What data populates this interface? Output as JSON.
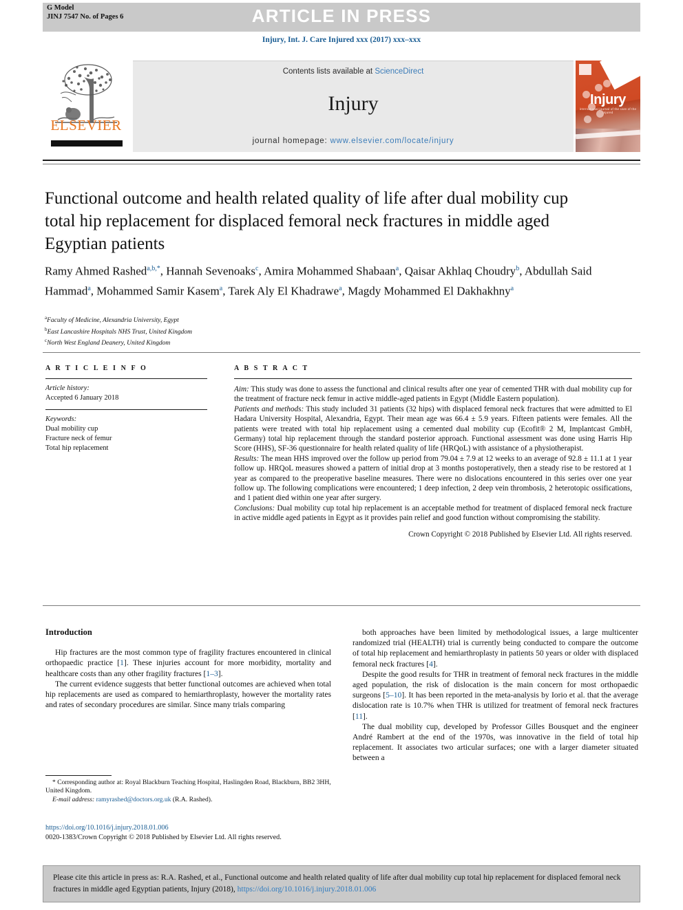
{
  "header": {
    "g_model_line1": "G Model",
    "g_model_line2": "JINJ 7547 No. of Pages 6",
    "article_in_press": "ARTICLE IN PRESS",
    "journal_citation": "Injury, Int. J. Care Injured xxx (2017) xxx–xxx"
  },
  "masthead": {
    "contents_prefix": "Contents lists available at ",
    "sciencedirect": "ScienceDirect",
    "journal_name": "Injury",
    "homepage_label": "journal homepage: ",
    "homepage_url": "www.elsevier.com/locate/injury",
    "publisher": "ELSEVIER",
    "cover_title": "Injury",
    "cover_subtitle": "international journal of the care of the injured"
  },
  "article": {
    "title": "Functional outcome and health related quality of life after dual mobility cup total hip replacement for displaced femoral neck fractures in middle aged Egyptian patients",
    "authors": [
      {
        "name": "Ramy Ahmed Rashed",
        "sup": "a,b,*"
      },
      {
        "name": "Hannah Sevenoaks",
        "sup": "c"
      },
      {
        "name": "Amira Mohammed Shabaan",
        "sup": "a"
      },
      {
        "name": "Qaisar Akhlaq Choudry",
        "sup": "b"
      },
      {
        "name": "Abdullah Said Hammad",
        "sup": "a"
      },
      {
        "name": "Mohammed Samir Kasem",
        "sup": "a"
      },
      {
        "name": "Tarek Aly El Khadrawe",
        "sup": "a"
      },
      {
        "name": "Magdy Mohammed El Dakhakhny",
        "sup": "a"
      }
    ],
    "affiliations": [
      {
        "mark": "a",
        "text": "Faculty of Medicine, Alexandria University, Egypt"
      },
      {
        "mark": "b",
        "text": "East Lancashire Hospitals NHS Trust, United Kingdom"
      },
      {
        "mark": "c",
        "text": "North West England Deanery, United Kingdom"
      }
    ]
  },
  "article_info": {
    "heading": "A R T I C L E  I N F O",
    "history_label": "Article history:",
    "history_value": "Accepted 6 January 2018",
    "keywords_label": "Keywords:",
    "keywords": [
      "Dual mobility cup",
      "Fracture neck of femur",
      "Total hip replacement"
    ]
  },
  "abstract": {
    "heading": "A B S T R A C T",
    "sections": [
      {
        "label": "Aim:",
        "text": " This study was done to assess the functional and clinical results after one year of cemented THR with dual mobility cup for the treatment of fracture neck femur in active middle-aged patients in Egypt (Middle Eastern population)."
      },
      {
        "label": "Patients and methods:",
        "text": " This study included 31 patients (32 hips) with displaced femoral neck fractures that were admitted to El Hadara University Hospital, Alexandria, Egypt. Their mean age was 66.4 ± 5.9 years. Fifteen patients were females. All the patients were treated with total hip replacement using a cemented dual mobility cup (Ecofit® 2 M, Implantcast GmbH, Germany) total hip replacement through the standard posterior approach. Functional assessment was done using Harris Hip Score (HHS), SF-36 questionnaire for health related quality of life (HRQoL) with assistance of a physiotherapist."
      },
      {
        "label": "Results:",
        "text": " The mean HHS improved over the follow up period from 79.04 ± 7.9 at 12 weeks to an average of 92.8 ± 11.1 at 1 year follow up. HRQoL measures showed a pattern of initial drop at 3 months postoperatively, then a steady rise to be restored at 1 year as compared to the preoperative baseline measures. There were no dislocations encountered in this series over one year follow up. The following complications were encountered; 1 deep infection, 2 deep vein thrombosis, 2 heterotopic ossifications, and 1 patient died within one year after surgery."
      },
      {
        "label": "Conclusions:",
        "text": " Dual mobility cup total hip replacement is an acceptable method for treatment of displaced femoral neck fracture in active middle aged patients in Egypt as it provides pain relief and good function without compromising the stability."
      }
    ],
    "copyright": "Crown Copyright © 2018 Published by Elsevier Ltd. All rights reserved."
  },
  "introduction": {
    "heading": "Introduction",
    "left_paragraphs": [
      "Hip fractures are the most common type of fragility fractures encountered in clinical orthopaedic practice [1]. These injuries account for more morbidity, mortality and healthcare costs than any other fragility fractures [1–3].",
      "The current evidence suggests that better functional outcomes are achieved when total hip replacements are used as compared to hemiarthroplasty, however the mortality rates and rates of secondary procedures are similar. Since many trials comparing"
    ],
    "right_paragraphs": [
      "both approaches have been limited by methodological issues, a large multicenter randomized trial (HEALTH) trial is currently being conducted to compare the outcome of total hip replacement and hemiarthroplasty in patients 50 years or older with displaced femoral neck fractures [4].",
      "Despite the good results for THR in treatment of femoral neck fractures in the middle aged population, the risk of dislocation is the main concern for most orthopaedic surgeons [5–10]. It has been reported in the meta-analysis by Iorio et al. that the average dislocation rate is 10.7% when THR is utilized for treatment of femoral neck fractures [11].",
      "The dual mobility cup, developed by Professor Gilles Bousquet and the engineer André Rambert at the end of the 1970s, was innovative in the field of total hip replacement. It associates two articular surfaces; one with a larger diameter situated between a"
    ]
  },
  "footnote": {
    "corresponding_marker": "*",
    "corresponding_text": " Corresponding author at: Royal Blackburn Teaching Hospital, Haslingden Road, Blackburn, BB2 3HH, United Kingdom.",
    "email_label": "E-mail address:",
    "email_address": "ramyrashed@doctors.org.uk",
    "email_owner": " (R.A. Rashed).",
    "doi": "https://doi.org/10.1016/j.injury.2018.01.006",
    "issn_line": "0020-1383/Crown Copyright © 2018 Published by Elsevier Ltd. All rights reserved."
  },
  "cite_box": {
    "text": "Please cite this article in press as: R.A. Rashed, et al., Functional outcome and health related quality of life after dual mobility cup total hip replacement for displaced femoral neck fractures in middle aged Egyptian patients, Injury (2018), ",
    "doi": "https://doi.org/10.1016/j.injury.2018.01.006"
  },
  "colors": {
    "link_blue": "#1a5d93",
    "elsevier_orange": "#E87722",
    "band_grey": "#c9c9c9",
    "masthead_grey": "#e9e9e9",
    "cover_orange": "#cf4a24"
  }
}
